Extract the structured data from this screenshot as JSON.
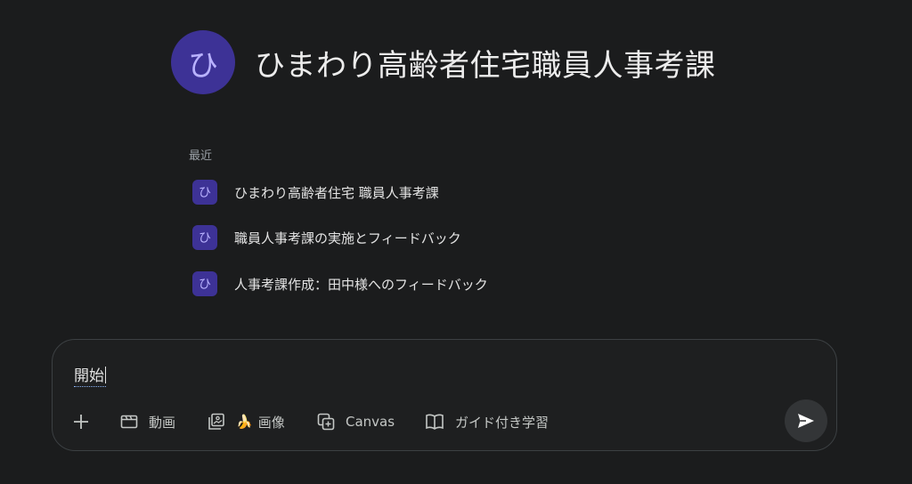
{
  "header": {
    "avatar_char": "ひ",
    "title": "ひまわり高齢者住宅職員人事考課"
  },
  "recent": {
    "label": "最近",
    "items": [
      {
        "avatar_char": "ひ",
        "label": "ひまわり高齢者住宅 職員人事考課"
      },
      {
        "avatar_char": "ひ",
        "label": "職員人事考課の実施とフィードバック"
      },
      {
        "avatar_char": "ひ",
        "label": "人事考課作成：田中様へのフィードバック"
      }
    ]
  },
  "composer": {
    "input_value": "開始",
    "tools": {
      "add_icon": "plus-icon",
      "video": {
        "icon": "video-icon",
        "label": "動画"
      },
      "image": {
        "icon": "image-icon",
        "emoji": "🍌",
        "label": "画像"
      },
      "canvas": {
        "icon": "canvas-icon",
        "label": "Canvas"
      },
      "guided": {
        "icon": "book-icon",
        "label": "ガイド付き学習"
      }
    },
    "send_icon": "send-icon"
  },
  "colors": {
    "background": "#1b1c1d",
    "avatar_bg": "#3d3296",
    "avatar_fg": "#b9b2ff",
    "composer_border": "#3c4043"
  }
}
